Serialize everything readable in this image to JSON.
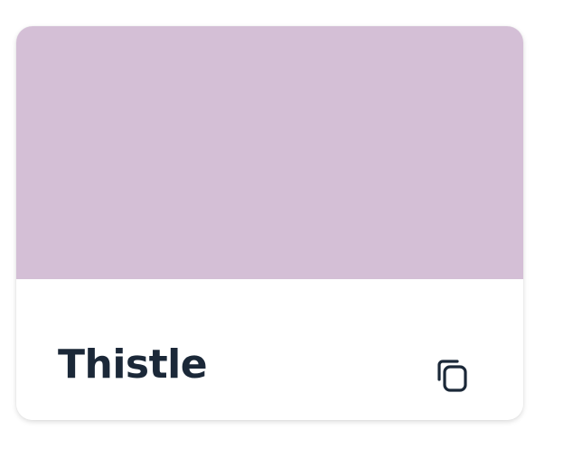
{
  "card": {
    "color_name": "Thistle",
    "swatch_color": "#d4bfd6",
    "text_color": "#1b2838",
    "copy_icon": "copy-icon"
  }
}
